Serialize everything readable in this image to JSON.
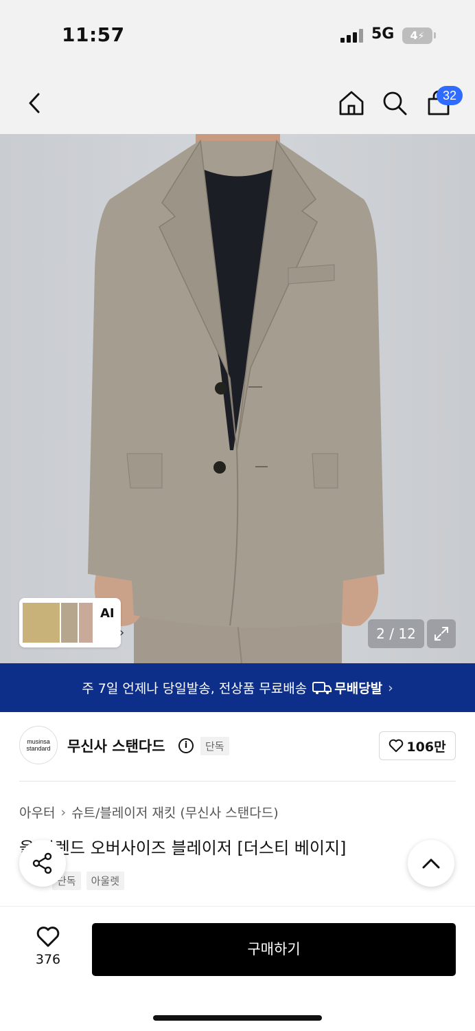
{
  "status": {
    "time": "11:57",
    "network": "5G",
    "battery": "4"
  },
  "nav": {
    "cart_count": "32"
  },
  "gallery": {
    "counter": "2 / 12",
    "ai_label": "AI"
  },
  "banner": {
    "text": "주 7일 언제나 당일발송, 전상품 무료배송",
    "tag": "무배당발"
  },
  "brand": {
    "logo_line1": "musinsa",
    "logo_line2": "standard",
    "name": "무신사 스탠다드",
    "chip": "단독",
    "likes": "106만"
  },
  "breadcrumb": {
    "level1": "아우터",
    "level2": "슈트/블레이저 재킷 (무신사 스탠다드)"
  },
  "product": {
    "title": "울 블렌드 오버사이즈 블레이저 [더스티 베이지]",
    "tags": [
      "단독",
      "아울렛"
    ]
  },
  "bottom": {
    "wish_count": "376",
    "buy_label": "구매하기"
  },
  "colors": {
    "banner": "#0d2f8a",
    "badge": "#2f6bff",
    "jacket": "#a59d90"
  }
}
